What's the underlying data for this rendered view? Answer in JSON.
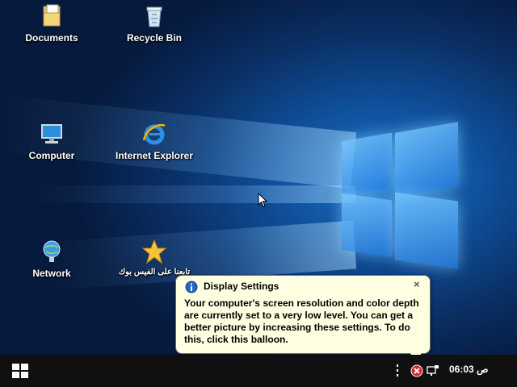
{
  "desktop": {
    "icons": [
      {
        "label": "Documents"
      },
      {
        "label": "Recycle Bin"
      },
      {
        "label": "Computer"
      },
      {
        "label": "Internet Explorer"
      },
      {
        "label": "Network"
      },
      {
        "label": "تابعنا على الفيس بوك"
      }
    ]
  },
  "balloon": {
    "title": "Display Settings",
    "close_glyph": "×",
    "body": "Your computer's screen resolution and color depth are currently set to a very low level. You can get a better picture by increasing these settings. To do this, click this balloon."
  },
  "taskbar": {
    "clock": "06:03 ص"
  },
  "icon_names": [
    "documents-icon",
    "recycle-bin-icon",
    "computer-icon",
    "internet-explorer-icon",
    "network-icon",
    "star-shortcut-icon",
    "info-icon",
    "windows-logo-icon",
    "error-x-icon",
    "network-tray-icon",
    "mouse-cursor-icon"
  ],
  "colors": {
    "balloon_bg": "#ffffe1",
    "taskbar_bg": "#101010",
    "accent": "#1a73c9",
    "error": "#d9252a"
  }
}
